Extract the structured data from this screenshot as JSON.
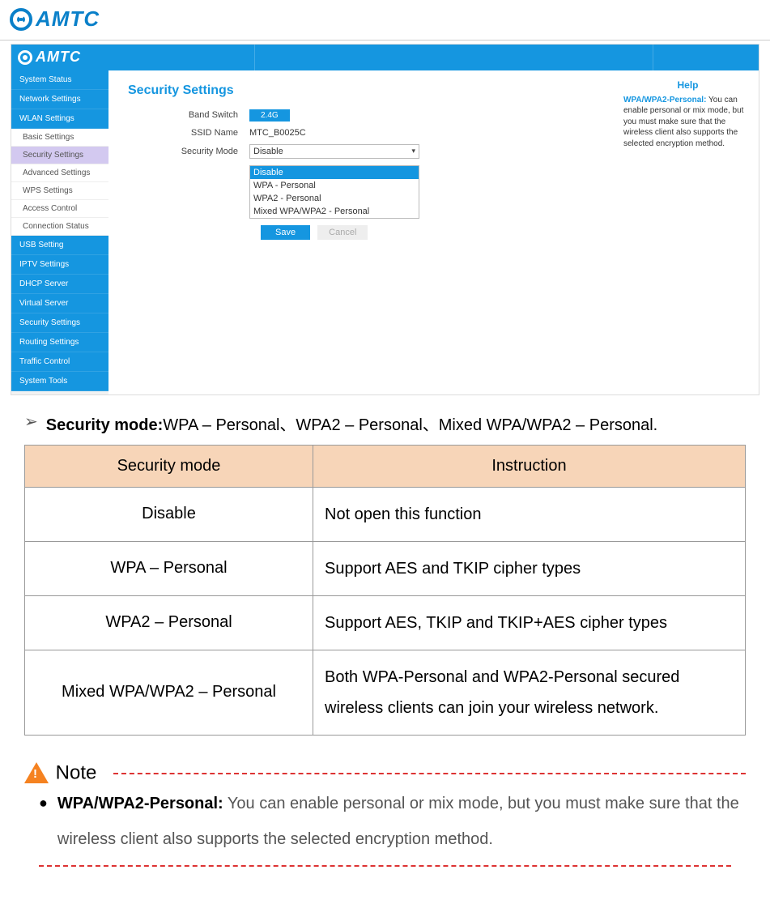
{
  "logo_text": "AMTC",
  "router": {
    "sidebar_main": [
      "System Status",
      "Network Settings",
      "WLAN Settings"
    ],
    "sidebar_sub": [
      "Basic Settings",
      "Security Settings",
      "Advanced Settings",
      "WPS Settings",
      "Access Control",
      "Connection Status"
    ],
    "sidebar_rest": [
      "USB Setting",
      "IPTV Settings",
      "DHCP Server",
      "Virtual Server",
      "Security Settings",
      "Routing Settings",
      "Traffic Control",
      "System Tools"
    ],
    "title": "Security Settings",
    "band_label": "Band Switch",
    "band_value": "2.4G",
    "ssid_label": "SSID Name",
    "ssid_value": "MTC_B0025C",
    "mode_label": "Security Mode",
    "mode_selected": "Disable",
    "mode_options": [
      "Disable",
      "WPA - Personal",
      "WPA2 - Personal",
      "Mixed WPA/WPA2 - Personal"
    ],
    "save": "Save",
    "cancel": "Cancel",
    "help_title": "Help",
    "help_strong": "WPA/WPA2-Personal:",
    "help_body": " You can enable personal or mix mode, but you must make sure that the wireless client also supports the selected encryption method."
  },
  "doc": {
    "heading_label": "Security mode:",
    "heading_rest": "WPA – Personal、WPA2 – Personal、Mixed WPA/WPA2 – Personal.",
    "table": {
      "head1": "Security mode",
      "head2": "Instruction",
      "rows": [
        {
          "mode": "Disable",
          "desc": "Not open this function"
        },
        {
          "mode": "WPA – Personal",
          "desc": "Support AES and TKIP cipher types"
        },
        {
          "mode": "WPA2 – Personal",
          "desc": "Support AES, TKIP and TKIP+AES cipher types"
        },
        {
          "mode": "Mixed WPA/WPA2 – Personal",
          "desc": "Both WPA-Personal and WPA2-Personal secured wireless clients can join your wireless network."
        }
      ]
    },
    "note_label": "Note",
    "note_strong": "WPA/WPA2-Personal:",
    "note_body": " You can enable personal or mix mode, but you must make sure that the wireless client also supports the selected encryption method."
  }
}
